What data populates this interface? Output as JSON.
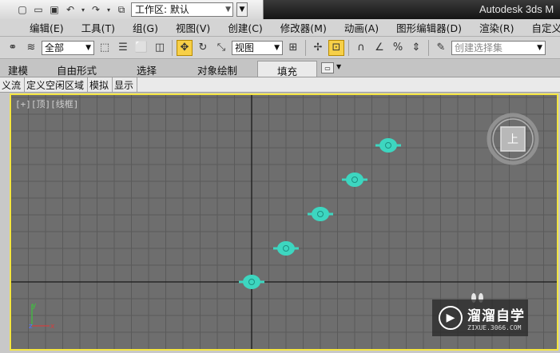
{
  "app": {
    "title": "Autodesk 3ds M",
    "workspace_label": "工作区: 默认"
  },
  "menu": [
    "编辑(E)",
    "工具(T)",
    "组(G)",
    "视图(V)",
    "创建(C)",
    "修改器(M)",
    "动画(A)",
    "图形编辑器(D)",
    "渲染(R)",
    "自定义(U)"
  ],
  "toolbar": {
    "selection_filter": "全部",
    "reference_coord": "视图",
    "named_selection_placeholder": "创建选择集"
  },
  "ribbon": {
    "tabs": [
      "建模",
      "自由形式",
      "选择",
      "对象绘制",
      "填充"
    ],
    "active_tab": "填充"
  },
  "subribbon": [
    "义流",
    "定义空闲区域",
    "模拟",
    "显示"
  ],
  "viewport": {
    "label": "[+][顶][线框]",
    "viewcube_face": "上",
    "axis_x": "x",
    "axis_y": "y",
    "axis_z": "z",
    "grid_color": "#6e6e6e",
    "object_color": "#3dd6c0",
    "object_count": 5
  },
  "watermark": {
    "title": "溜溜自学",
    "url": "ZIXUE.3066.COM"
  },
  "colors": {
    "viewport_border": "#f5e642",
    "active_tool": "#f7d048"
  }
}
